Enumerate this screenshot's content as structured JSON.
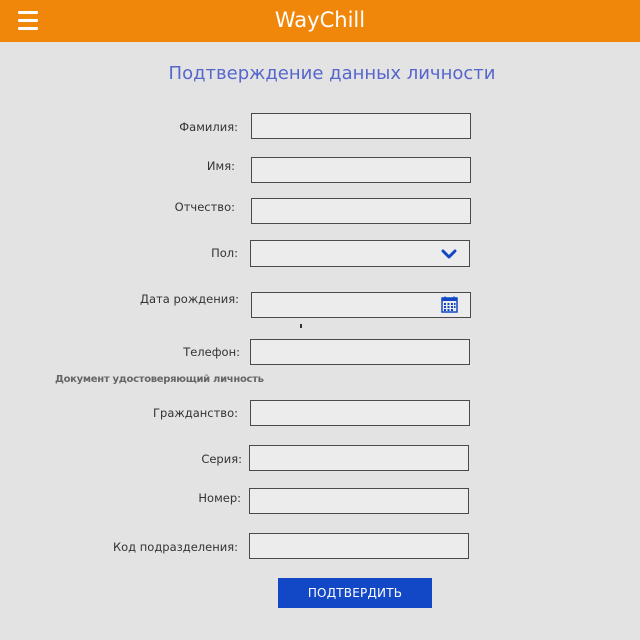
{
  "header": {
    "title": "WayChill",
    "menu_icon": "hamburger-menu-icon",
    "background_color": "#f0870a"
  },
  "form": {
    "title": "Подтверждение данных личности",
    "fields": {
      "last_name": {
        "label": "Фамилия:",
        "value": ""
      },
      "first_name": {
        "label": "Имя:",
        "value": ""
      },
      "patronymic": {
        "label": "Отчество:",
        "value": ""
      },
      "gender": {
        "label": "Пол:",
        "value": ""
      },
      "birth_date": {
        "label": "Дата рождения:",
        "value": ""
      },
      "phone": {
        "label": "Телефон:",
        "value": ""
      }
    },
    "document_section_label": "Документ удостоверяющий личность",
    "document_fields": {
      "citizenship": {
        "label": "Гражданство:",
        "value": ""
      },
      "series": {
        "label": "Серия:",
        "value": ""
      },
      "number": {
        "label": "Номер:",
        "value": ""
      },
      "division_code": {
        "label": "Код подразделения:",
        "value": ""
      }
    },
    "submit_label": "ПОДТВЕРДИТЬ",
    "accent_color": "#1248c6",
    "title_color": "#5566cc"
  }
}
